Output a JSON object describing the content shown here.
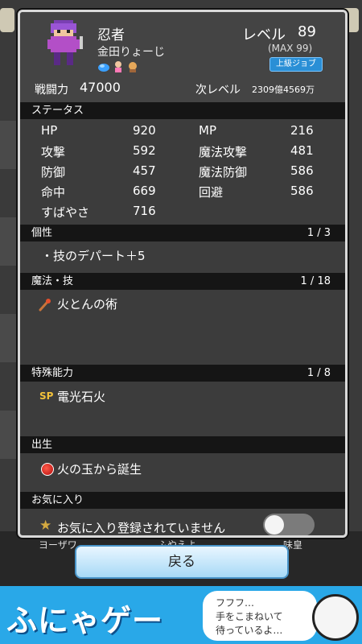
{
  "background": {
    "bottom_names": [
      "ヨーザワ",
      "ふやえよ",
      "味皇"
    ]
  },
  "character": {
    "job": "忍者",
    "name": "金田りょーじ",
    "level_label": "レベル",
    "level": "89",
    "max_level": "(MAX 99)",
    "job_rank": "上級ジョブ",
    "power_label": "戦闘力",
    "power": "47000",
    "next_label": "次レベル",
    "next_value": "2309億4569万"
  },
  "sections": {
    "status": {
      "title": "ステータス"
    },
    "traits": {
      "title": "個性",
      "count": "1 / 3",
      "items": [
        "・技のデパート＋5"
      ]
    },
    "magic": {
      "title": "魔法・技",
      "count": "1 / 18",
      "items": [
        "火とんの術"
      ]
    },
    "special": {
      "title": "特殊能力",
      "count": "1 / 8",
      "tag": "SP",
      "items": [
        "電光石火"
      ]
    },
    "origin": {
      "title": "出生",
      "value": "火の玉から誕生"
    },
    "favorite": {
      "title": "お気に入り",
      "value": "お気に入り登録されていません"
    }
  },
  "stats": {
    "left": [
      {
        "label": "HP",
        "value": "920"
      },
      {
        "label": "攻撃",
        "value": "592"
      },
      {
        "label": "防御",
        "value": "457"
      },
      {
        "label": "命中",
        "value": "669"
      },
      {
        "label": "すばやさ",
        "value": "716"
      }
    ],
    "right": [
      {
        "label": "MP",
        "value": "216"
      },
      {
        "label": "魔法攻撃",
        "value": "481"
      },
      {
        "label": "魔法防御",
        "value": "586"
      },
      {
        "label": "回避",
        "value": "586"
      }
    ]
  },
  "buttons": {
    "back": "戻る"
  },
  "ad": {
    "title": "ふにゃゲー",
    "bubble_lines": [
      "フフフ…",
      "手をこまねいて",
      "待っているよ…"
    ]
  }
}
